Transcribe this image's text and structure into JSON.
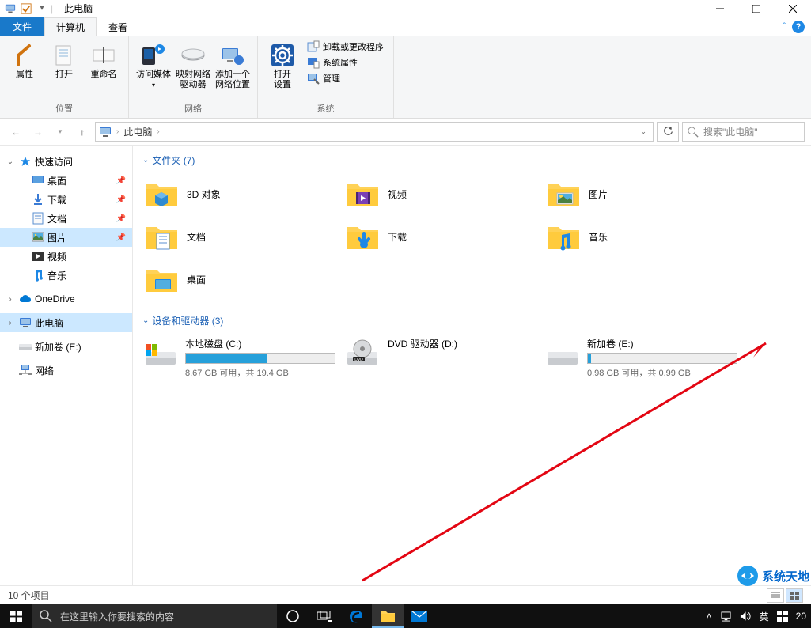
{
  "window": {
    "title": "此电脑"
  },
  "ribbon": {
    "file_tab": "文件",
    "tabs": [
      "计算机",
      "查看"
    ],
    "active_tab": 0,
    "groups": {
      "location": {
        "label": "位置",
        "btns": {
          "properties": "属性",
          "open": "打开",
          "rename": "重命名"
        }
      },
      "network": {
        "label": "网络",
        "btns": {
          "access_media": "访问媒体",
          "map_drive": "映射网络\n驱动器",
          "add_location": "添加一个\n网络位置"
        }
      },
      "system": {
        "label": "系统",
        "open_settings": "打开\n设置",
        "small": {
          "uninstall": "卸载或更改程序",
          "sysprops": "系统属性",
          "manage": "管理"
        }
      }
    }
  },
  "address": {
    "crumb": "此电脑",
    "search_placeholder": "搜索\"此电脑\""
  },
  "nav": {
    "quick_access": "快速访问",
    "items": [
      {
        "label": "桌面",
        "pinned": true
      },
      {
        "label": "下载",
        "pinned": true
      },
      {
        "label": "文档",
        "pinned": true
      },
      {
        "label": "图片",
        "pinned": true,
        "selected": true
      },
      {
        "label": "视频"
      },
      {
        "label": "音乐"
      }
    ],
    "onedrive": "OneDrive",
    "this_pc": "此电脑",
    "new_volume": "新加卷 (E:)",
    "network": "网络"
  },
  "content": {
    "folders_header": "文件夹 (7)",
    "folders": [
      "3D 对象",
      "视频",
      "图片",
      "文档",
      "下载",
      "音乐",
      "桌面"
    ],
    "drives_header": "设备和驱动器 (3)",
    "drives": [
      {
        "name": "本地磁盘 (C:)",
        "free": "8.67 GB 可用，共 19.4 GB",
        "used_pct": 55,
        "has_bar": true,
        "osdrive": true
      },
      {
        "name": "DVD 驱动器 (D:)",
        "has_bar": false,
        "dvd": true
      },
      {
        "name": "新加卷 (E:)",
        "free": "0.98 GB 可用，共 0.99 GB",
        "used_pct": 2,
        "has_bar": true
      }
    ]
  },
  "statusbar": {
    "count": "10 个项目"
  },
  "taskbar": {
    "search_placeholder": "在这里输入你要搜索的内容",
    "ime": "英",
    "time_partial": "20"
  },
  "watermark": "系统天地"
}
